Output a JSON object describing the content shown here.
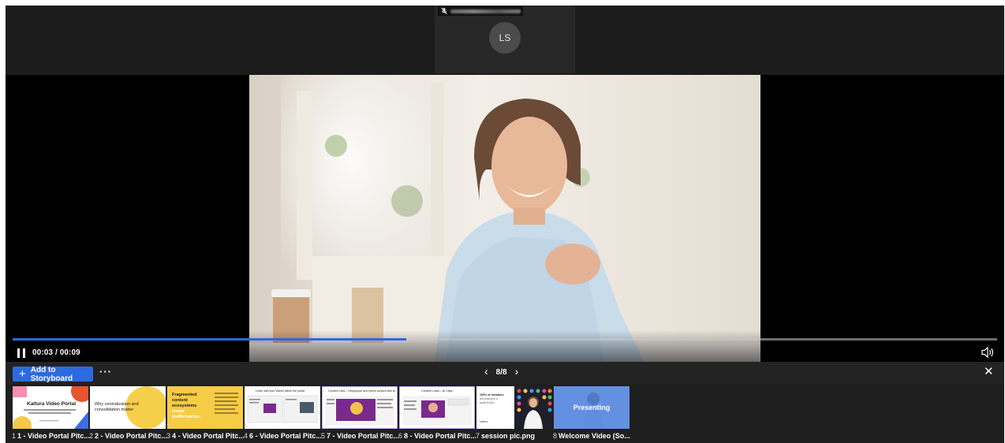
{
  "participant": {
    "initials": "LS",
    "mic_icon": "mic-muted-icon"
  },
  "player": {
    "time": "00:03 / 00:09",
    "progress": 0.4,
    "pause_icon": "pause-icon",
    "volume_icon": "volume-icon"
  },
  "toolbar": {
    "add_label": "Add to Storyboard",
    "more_label": "···",
    "page_label": "8/8",
    "prev_icon": "chevron-left-icon",
    "next_icon": "chevron-right-icon",
    "close_icon": "close-icon"
  },
  "slide_texts": {
    "s1": "Kaltura Video Portal",
    "s2": "Why centralization and consolidation matter",
    "s3": [
      "Fragmented",
      "content",
      "ecosystems",
      "create",
      "inefficiencies."
    ],
    "s4": "Learn with your videos within the portal",
    "s5": "Content Labs – Repurpose and enrich content with AI",
    "s6": "Content Labs – AI Clips",
    "s7": [
      "100% of members",
      "are looking for a",
      "portal to find..."
    ],
    "s7_brand": "kaltura"
  },
  "thumbnails": [
    {
      "num": "1",
      "name": "1 - Video Portal Pitc..."
    },
    {
      "num": "2",
      "name": "2 - Video Portal Pitc..."
    },
    {
      "num": "3",
      "name": "4 - Video Portal Pitc..."
    },
    {
      "num": "4",
      "name": "6 - Video Portal Pitc..."
    },
    {
      "num": "5",
      "name": "7 - Video Portal Pitc..."
    },
    {
      "num": "6",
      "name": "8 - Video Portal Pitc..."
    },
    {
      "num": "7",
      "name": "session pic.png"
    },
    {
      "num": "8",
      "name": "Welcome Video (So...",
      "overlay": "Presenting"
    }
  ],
  "colors": {
    "accent": "#2d6ae0",
    "background": "#1f1f1f"
  }
}
